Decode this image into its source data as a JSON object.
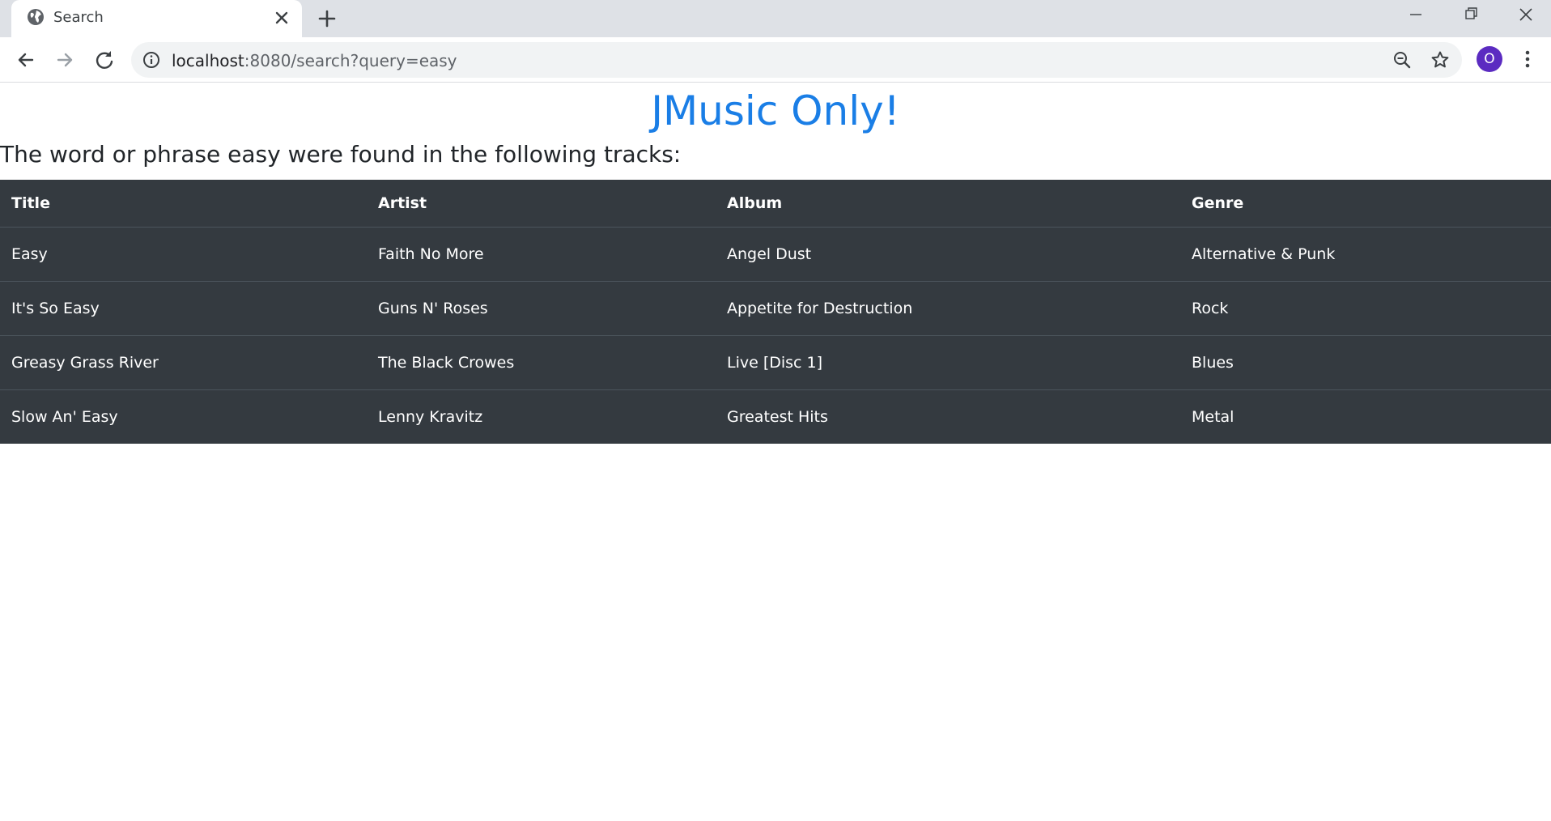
{
  "browser": {
    "tab_title": "Search",
    "url_host": "localhost",
    "url_rest": ":8080/search?query=easy",
    "avatar_initial": "O"
  },
  "page": {
    "brand": "JMusic Only!",
    "subtitle": "The word or phrase easy were found in the following tracks:",
    "brand_color": "#1a7ee6",
    "table_bg": "#343a40"
  },
  "table": {
    "headers": [
      "Title",
      "Artist",
      "Album",
      "Genre"
    ],
    "rows": [
      [
        "Easy",
        "Faith No More",
        "Angel Dust",
        "Alternative & Punk"
      ],
      [
        "It's So Easy",
        "Guns N' Roses",
        "Appetite for Destruction",
        "Rock"
      ],
      [
        "Greasy Grass River",
        "The Black Crowes",
        "Live [Disc 1]",
        "Blues"
      ],
      [
        "Slow An' Easy",
        "Lenny Kravitz",
        "Greatest Hits",
        "Metal"
      ]
    ]
  },
  "icons": {
    "favicon": "globe-icon",
    "tab_close": "close-icon",
    "new_tab": "plus-icon",
    "back": "arrow-left-icon",
    "forward": "arrow-right-icon",
    "reload": "reload-icon",
    "site_info": "info-icon",
    "zoom": "zoom-out-icon",
    "bookmark": "star-icon",
    "menu": "kebab-menu-icon"
  }
}
